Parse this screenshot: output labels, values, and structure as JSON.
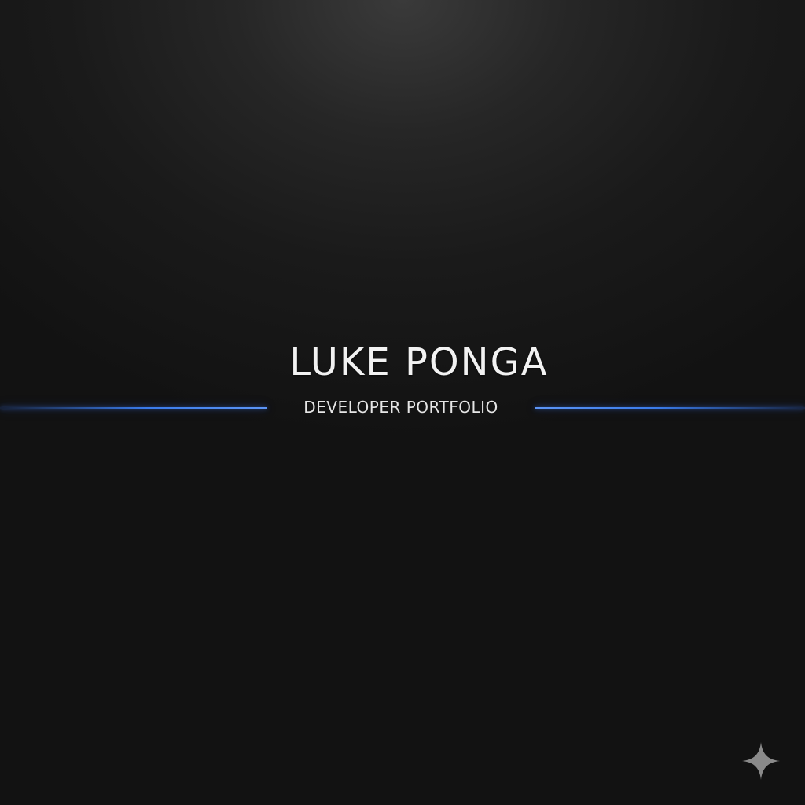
{
  "hero": {
    "title": "LUKE PONGA",
    "subtitle": "DEVELOPER PORTFOLIO"
  },
  "decor": {
    "accent_color": "#3a7bea",
    "corner_icon": "sparkle-icon"
  }
}
